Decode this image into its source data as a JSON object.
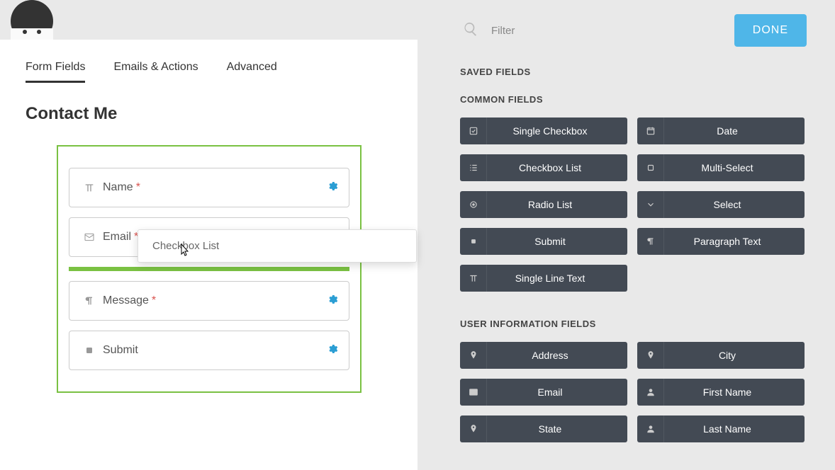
{
  "tabs": {
    "form_fields": "Form Fields",
    "emails_actions": "Emails & Actions",
    "advanced": "Advanced"
  },
  "form": {
    "title": "Contact Me",
    "fields": [
      {
        "label": "Name",
        "required": true,
        "icon": "text"
      },
      {
        "label": "Email",
        "required": true,
        "icon": "envelope"
      },
      {
        "label": "Message",
        "required": true,
        "icon": "paragraph"
      },
      {
        "label": "Submit",
        "required": false,
        "icon": "square"
      }
    ]
  },
  "drag": {
    "label": "Checkbox List"
  },
  "search": {
    "placeholder": "Filter"
  },
  "done_label": "DONE",
  "sections": {
    "saved": "SAVED FIELDS",
    "common": "COMMON FIELDS",
    "user_info": "USER INFORMATION FIELDS"
  },
  "common_fields": [
    {
      "label": "Single Checkbox",
      "icon": "check-square"
    },
    {
      "label": "Date",
      "icon": "calendar"
    },
    {
      "label": "Checkbox List",
      "icon": "list"
    },
    {
      "label": "Multi-Select",
      "icon": "square-o"
    },
    {
      "label": "Radio List",
      "icon": "dot-circle"
    },
    {
      "label": "Select",
      "icon": "chevron-down"
    },
    {
      "label": "Submit",
      "icon": "square"
    },
    {
      "label": "Paragraph Text",
      "icon": "paragraph"
    },
    {
      "label": "Single Line Text",
      "icon": "text"
    }
  ],
  "user_fields": [
    {
      "label": "Address",
      "icon": "marker"
    },
    {
      "label": "City",
      "icon": "marker"
    },
    {
      "label": "Email",
      "icon": "envelope"
    },
    {
      "label": "First Name",
      "icon": "user"
    },
    {
      "label": "State",
      "icon": "marker"
    },
    {
      "label": "Last Name",
      "icon": "user"
    }
  ]
}
